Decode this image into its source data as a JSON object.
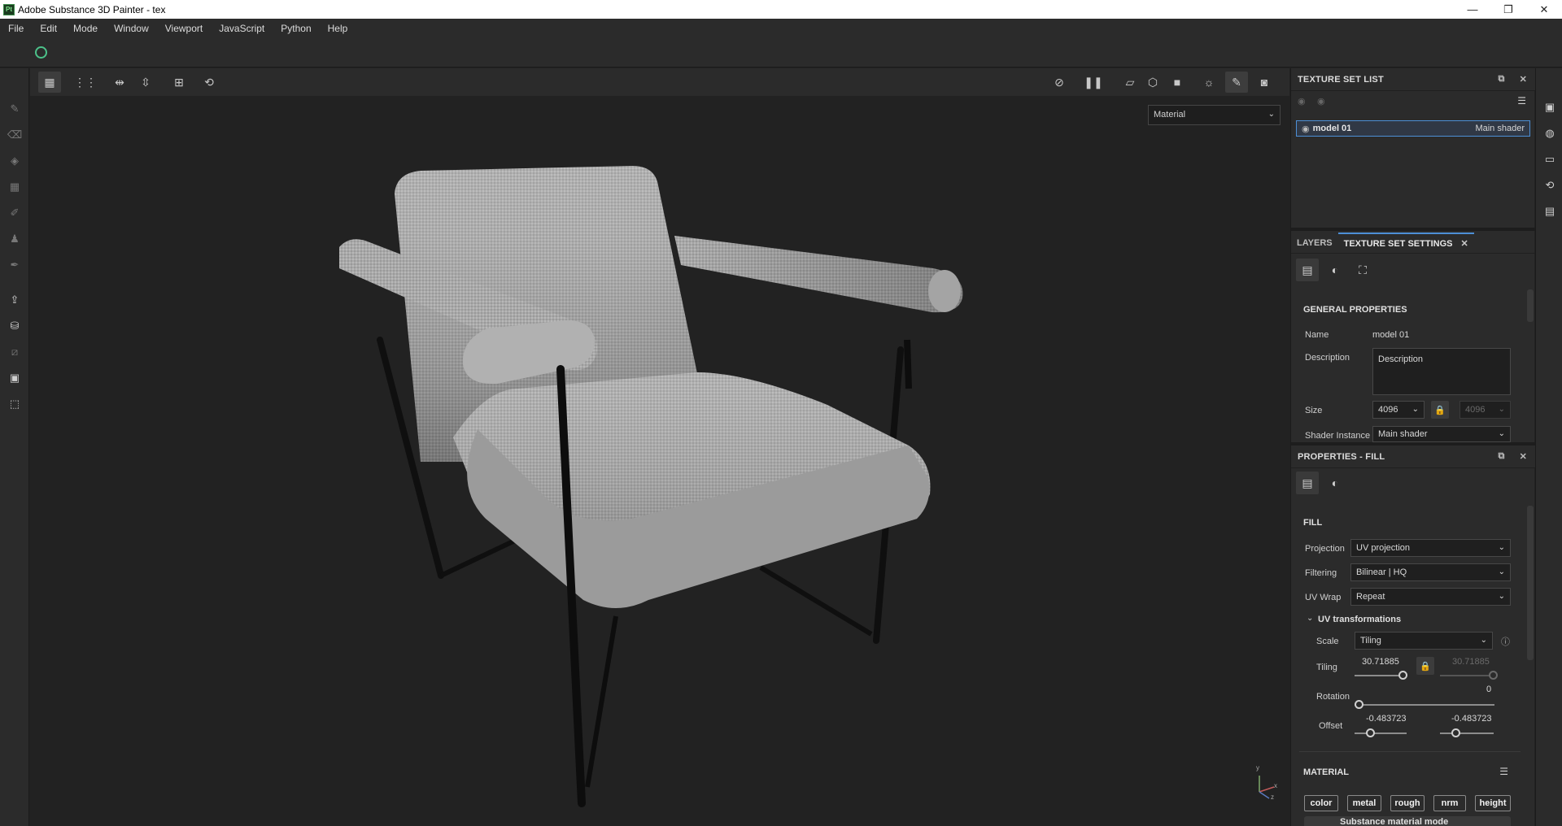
{
  "window": {
    "logo_text": "Pt",
    "title": "Adobe Substance 3D Painter - tex",
    "controls": [
      "—",
      "❐",
      "✕"
    ]
  },
  "menu": [
    "File",
    "Edit",
    "Mode",
    "Window",
    "Viewport",
    "JavaScript",
    "Python",
    "Help"
  ],
  "viewport": {
    "display_mode": "Material",
    "axis": {
      "y": "y",
      "x": "x",
      "z": "z"
    }
  },
  "texture_set_list": {
    "title": "TEXTURE SET LIST",
    "rows": [
      {
        "name": "model 01",
        "shader": "Main shader"
      }
    ]
  },
  "tabs": [
    {
      "label": "LAYERS"
    },
    {
      "label": "TEXTURE SET SETTINGS"
    }
  ],
  "general": {
    "title": "GENERAL PROPERTIES",
    "name_label": "Name",
    "name_value": "model 01",
    "description_label": "Description",
    "description_value": "Description",
    "size_label": "Size",
    "size_value": "4096",
    "size_value_2": "4096",
    "shader_label": "Shader Instance",
    "shader_value": "Main shader"
  },
  "properties": {
    "title": "PROPERTIES - FILL",
    "fill_title": "FILL",
    "projection_label": "Projection",
    "projection_value": "UV projection",
    "filtering_label": "Filtering",
    "filtering_value": "Bilinear | HQ",
    "uvwrap_label": "UV Wrap",
    "uvwrap_value": "Repeat",
    "uvt_title": "UV transformations",
    "scale_label": "Scale",
    "scale_value": "Tiling",
    "tiling_label": "Tiling",
    "tiling_value": "30.71885",
    "tiling_value_2": "30.71885",
    "rotation_label": "Rotation",
    "rotation_value": "0",
    "offset_label": "Offset",
    "offset_value": "-0.483723",
    "offset_value_2": "-0.483723",
    "material_title": "MATERIAL",
    "channels": [
      "color",
      "metal",
      "rough",
      "nrm",
      "height"
    ],
    "substance_mode": "Substance material mode"
  }
}
